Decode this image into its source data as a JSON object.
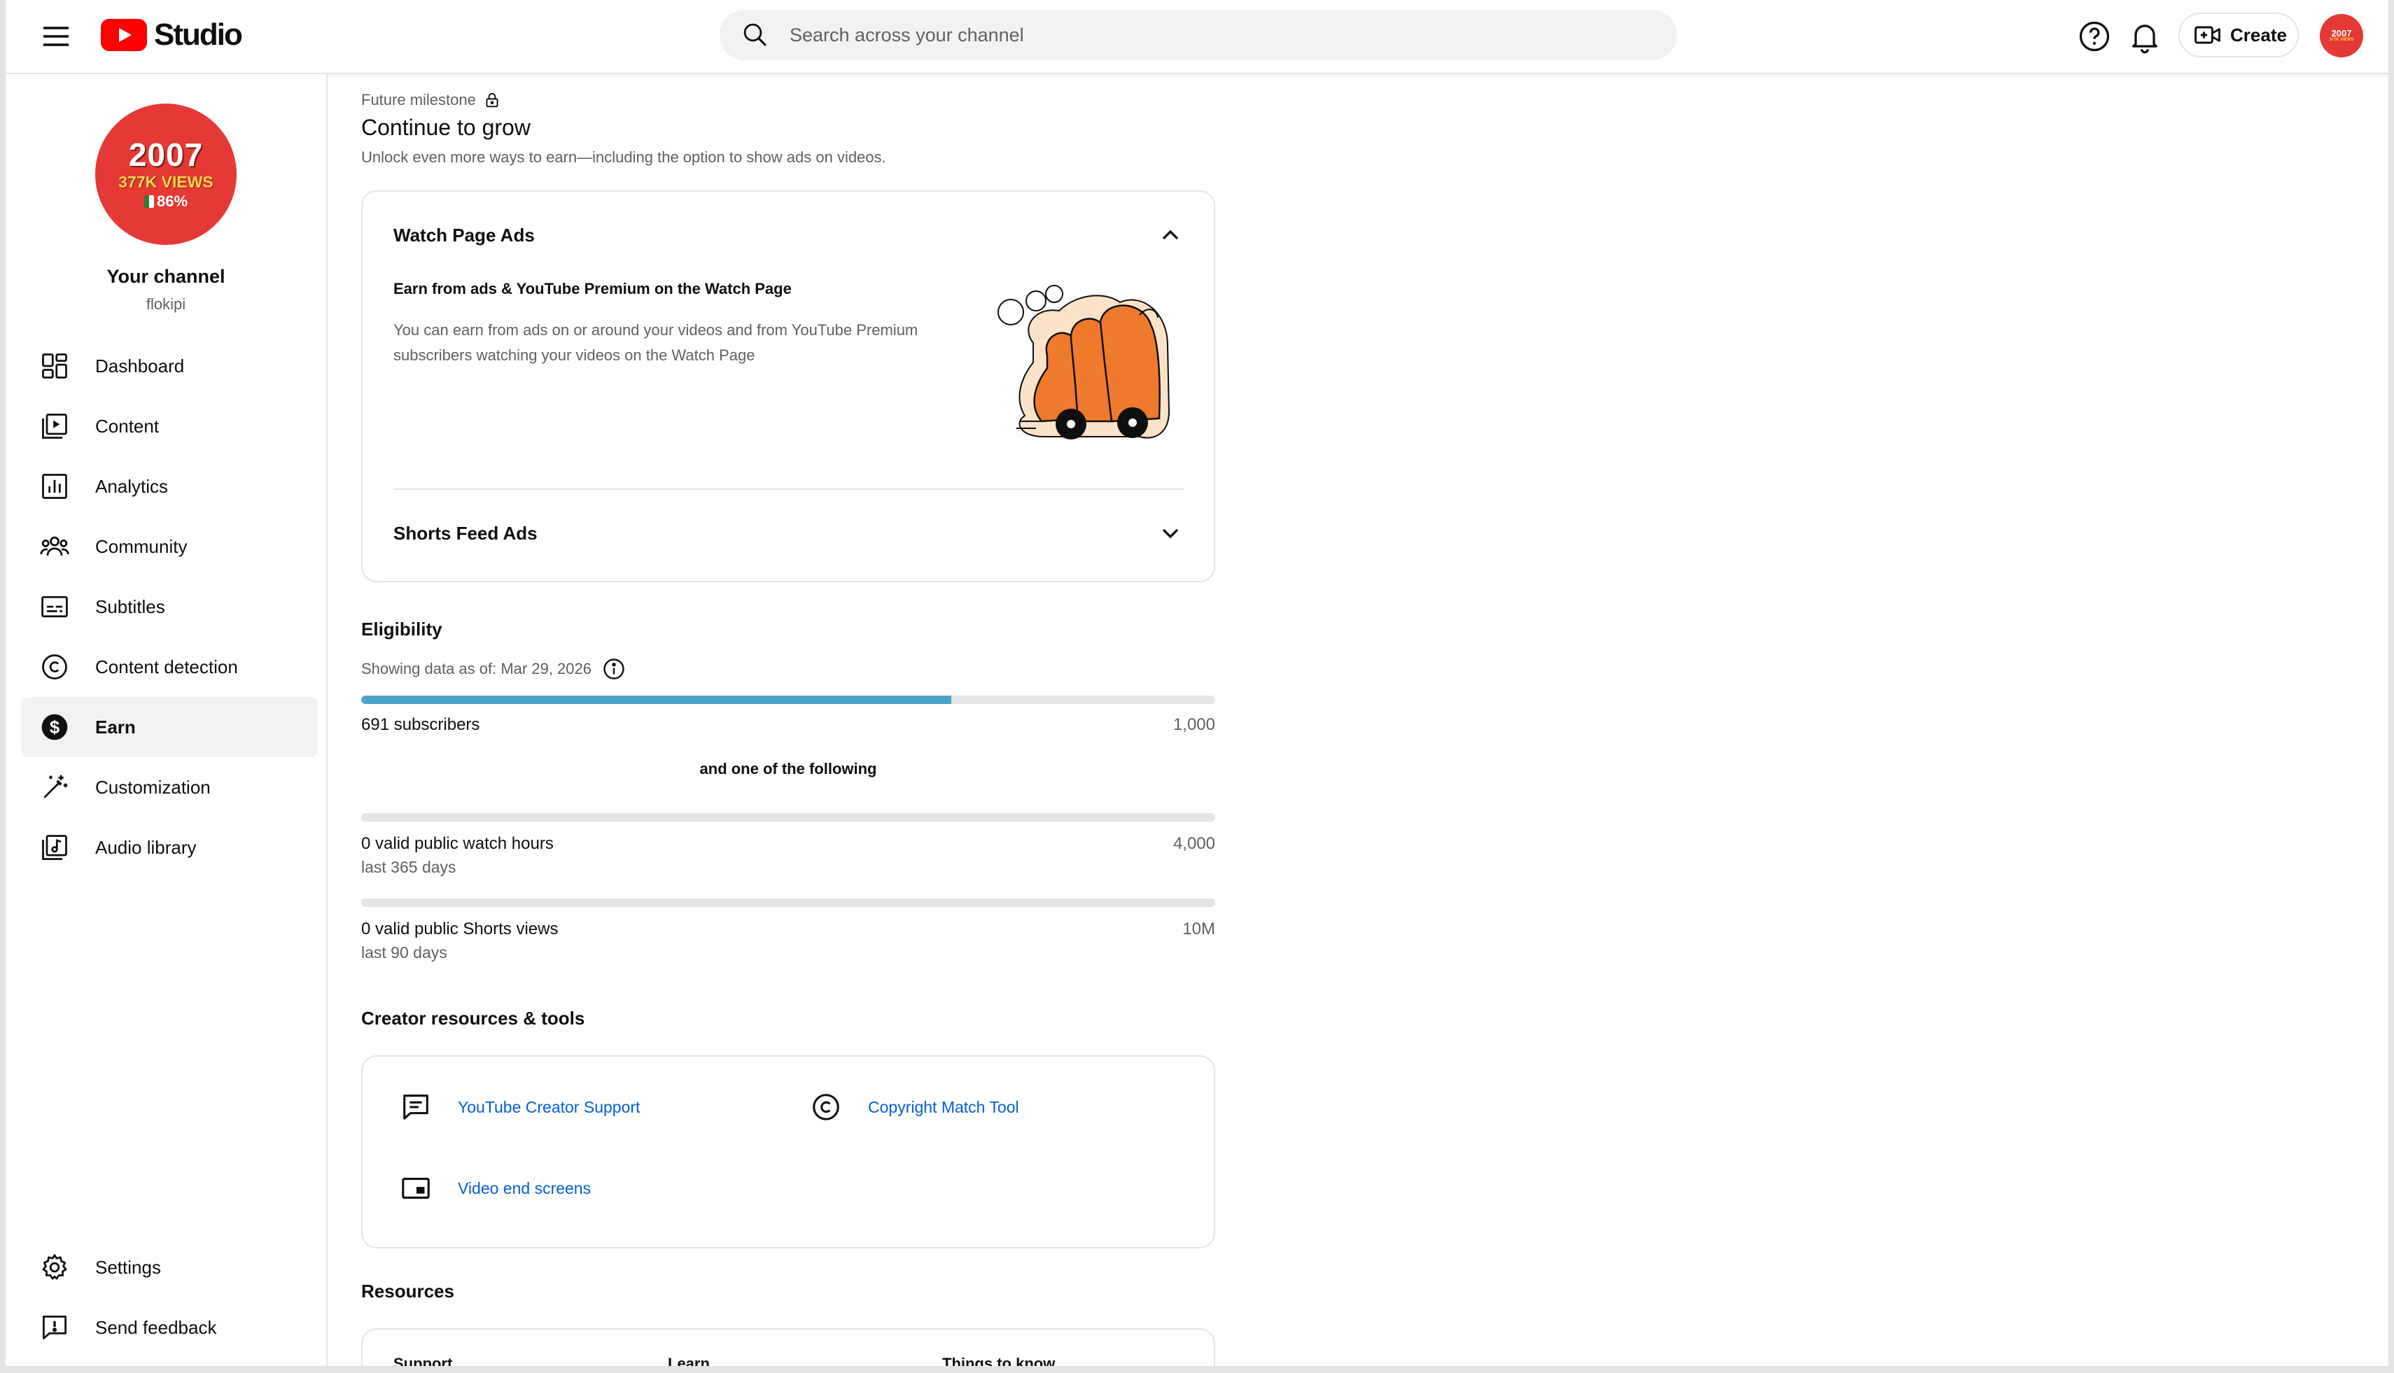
{
  "header": {
    "app_name": "Studio",
    "search_placeholder": "Search across your channel",
    "create_label": "Create",
    "avatar_text": "2007",
    "avatar_subtext": "377K VIEWS"
  },
  "channel": {
    "avatar_line1": "2007",
    "avatar_line2": "377K VIEWS",
    "avatar_line3": "86%",
    "title": "Your channel",
    "handle": "flokipi"
  },
  "sidebar": {
    "items": [
      {
        "label": "Dashboard",
        "icon": "dashboard-icon"
      },
      {
        "label": "Content",
        "icon": "content-icon"
      },
      {
        "label": "Analytics",
        "icon": "analytics-icon"
      },
      {
        "label": "Community",
        "icon": "community-icon"
      },
      {
        "label": "Subtitles",
        "icon": "subtitles-icon"
      },
      {
        "label": "Content detection",
        "icon": "copyright-icon"
      },
      {
        "label": "Earn",
        "icon": "dollar-icon",
        "active": true
      },
      {
        "label": "Customization",
        "icon": "magic-wand-icon"
      },
      {
        "label": "Audio library",
        "icon": "audio-library-icon"
      }
    ],
    "bottom_items": [
      {
        "label": "Settings",
        "icon": "gear-icon"
      },
      {
        "label": "Send feedback",
        "icon": "feedback-icon"
      }
    ]
  },
  "main": {
    "milestone_label": "Future milestone",
    "title": "Continue to grow",
    "subtitle": "Unlock even more ways to earn—including the option to show ads on videos.",
    "ads": {
      "watch_page": {
        "title": "Watch Page Ads",
        "subtitle": "Earn from ads & YouTube Premium on the Watch Page",
        "body": "You can earn from ads on or around your videos and from YouTube Premium subscribers watching your videos on the Watch Page",
        "expanded": true
      },
      "shorts_feed": {
        "title": "Shorts Feed Ads",
        "expanded": false
      }
    },
    "eligibility": {
      "title": "Eligibility",
      "as_of": "Showing data as of: Mar 29, 2026",
      "subscribers": {
        "label": "691 subscribers",
        "target": "1,000",
        "progress": 0.691
      },
      "or_text": "and one of the following",
      "watch_hours": {
        "label": "0 valid public watch hours",
        "target": "4,000",
        "period": "last 365 days",
        "progress": 0
      },
      "shorts_views": {
        "label": "0 valid public Shorts views",
        "target": "10M",
        "period": "last 90 days",
        "progress": 0
      }
    },
    "tools": {
      "title": "Creator resources & tools",
      "items": [
        {
          "label": "YouTube Creator Support",
          "icon": "chat-icon"
        },
        {
          "label": "Copyright Match Tool",
          "icon": "copyright-icon"
        },
        {
          "label": "Video end screens",
          "icon": "end-screen-icon"
        }
      ]
    },
    "resources": {
      "title": "Resources",
      "columns": [
        "Support",
        "Learn",
        "Things to know"
      ]
    }
  },
  "colors": {
    "brand_red": "#ff0000",
    "link_blue": "#065fd4",
    "progress_fill": "#4aa3c8",
    "illustration_orange": "#ef7a2b"
  }
}
